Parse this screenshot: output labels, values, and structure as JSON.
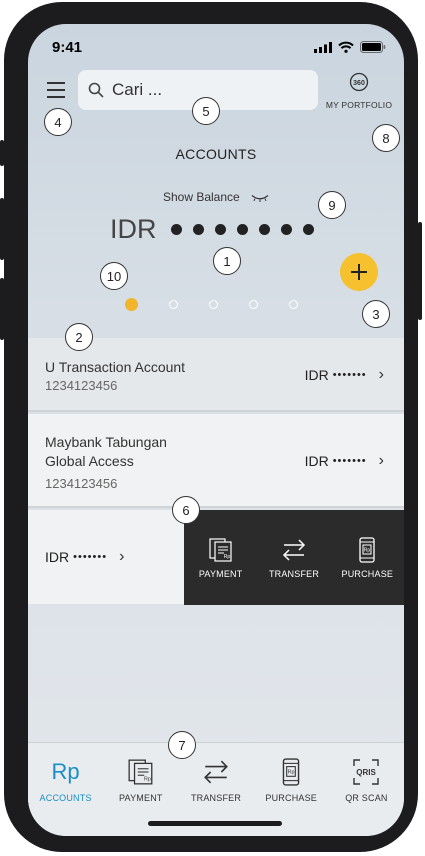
{
  "status": {
    "time": "9:41"
  },
  "search": {
    "placeholder": "Cari ..."
  },
  "portfolio": {
    "icon_text": "360",
    "label": "MY PORTFOLIO"
  },
  "page": {
    "title": "ACCOUNTS"
  },
  "balance": {
    "show_label": "Show Balance",
    "currency": "IDR",
    "masked_dots": 7
  },
  "carousel": {
    "total": 5,
    "active_index": 0
  },
  "accounts": [
    {
      "name": "U Transaction Account",
      "number": "1234123456",
      "currency": "IDR",
      "mask": "•••••••"
    },
    {
      "name": "Maybank Tabungan Global Access",
      "number": "1234123456",
      "currency": "IDR",
      "mask": "•••••••"
    },
    {
      "currency": "IDR",
      "mask": "•••••••"
    }
  ],
  "swipe_actions": [
    {
      "label": "PAYMENT",
      "icon": "payment-icon"
    },
    {
      "label": "TRANSFER",
      "icon": "transfer-icon"
    },
    {
      "label": "PURCHASE",
      "icon": "purchase-icon"
    }
  ],
  "bottom_nav": [
    {
      "label": "ACCOUNTS",
      "icon_text": "Rp",
      "icon": "rp-icon",
      "active": true
    },
    {
      "label": "PAYMENT",
      "icon": "payment-icon"
    },
    {
      "label": "TRANSFER",
      "icon": "transfer-icon"
    },
    {
      "label": "PURCHASE",
      "icon": "purchase-icon"
    },
    {
      "label": "QR SCAN",
      "icon_text": "QRIS",
      "icon": "qr-scan-icon"
    }
  ],
  "annotations": [
    "1",
    "2",
    "3",
    "4",
    "5",
    "6",
    "7",
    "8",
    "9",
    "10"
  ],
  "colors": {
    "accent": "#1b8ec7",
    "fab": "#f6c12f",
    "panel": "#2b2b2b"
  }
}
